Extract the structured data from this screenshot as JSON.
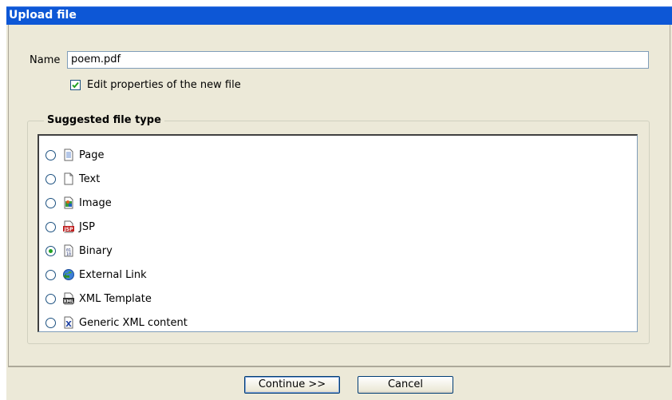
{
  "dialog": {
    "title": "Upload file"
  },
  "form": {
    "name_label": "Name",
    "name_value": "poem.pdf",
    "edit_properties_label": "Edit properties of the new file",
    "edit_properties_checked": true
  },
  "filetype": {
    "legend": "Suggested file type",
    "options": [
      {
        "label": "Page",
        "icon": "page-icon",
        "selected": false
      },
      {
        "label": "Text",
        "icon": "text-file-icon",
        "selected": false
      },
      {
        "label": "Image",
        "icon": "image-icon",
        "selected": false
      },
      {
        "label": "JSP",
        "icon": "jsp-icon",
        "selected": false
      },
      {
        "label": "Binary",
        "icon": "binary-icon",
        "selected": true
      },
      {
        "label": "External Link",
        "icon": "external-link-icon",
        "selected": false
      },
      {
        "label": "XML Template",
        "icon": "xml-template-icon",
        "selected": false
      },
      {
        "label": "Generic XML content",
        "icon": "generic-xml-icon",
        "selected": false
      }
    ]
  },
  "buttons": {
    "continue": "Continue >>",
    "cancel": "Cancel"
  },
  "colors": {
    "titlebar": "#0d57d6",
    "dialog_bg": "#ece9d8",
    "radio_selected": "#21a121"
  }
}
